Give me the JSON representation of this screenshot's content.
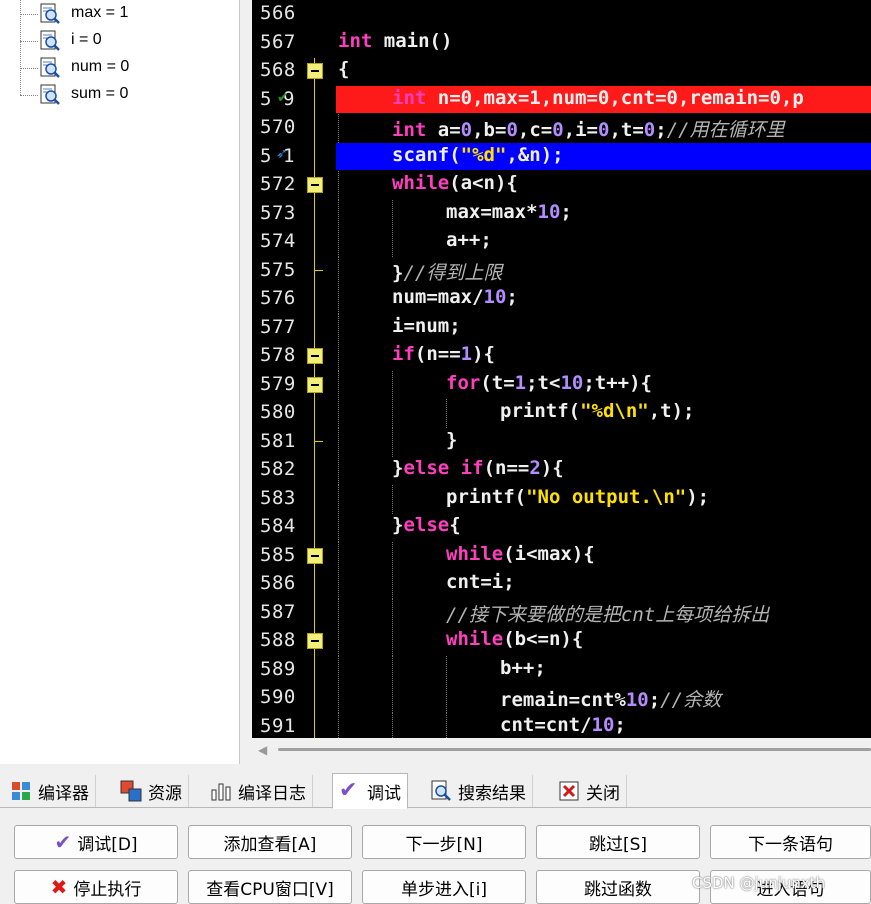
{
  "watch": {
    "items": [
      {
        "text": "max = 1"
      },
      {
        "text": "i = 0"
      },
      {
        "text": "num = 0"
      },
      {
        "text": "sum = 0"
      }
    ]
  },
  "editor": {
    "lines": [
      {
        "n": "566"
      },
      {
        "n": "567"
      },
      {
        "n": "568"
      },
      {
        "n": "5",
        "n2": "9"
      },
      {
        "n": "570"
      },
      {
        "n": "5",
        "n2": "1"
      },
      {
        "n": "572"
      },
      {
        "n": "573"
      },
      {
        "n": "574"
      },
      {
        "n": "575"
      },
      {
        "n": "576"
      },
      {
        "n": "577"
      },
      {
        "n": "578"
      },
      {
        "n": "579"
      },
      {
        "n": "580"
      },
      {
        "n": "581"
      },
      {
        "n": "582"
      },
      {
        "n": "583"
      },
      {
        "n": "584"
      },
      {
        "n": "585"
      },
      {
        "n": "586"
      },
      {
        "n": "587"
      },
      {
        "n": "588"
      },
      {
        "n": "589"
      },
      {
        "n": "590"
      },
      {
        "n": "591"
      }
    ],
    "code": {
      "l567": {
        "kw": "int",
        "rest": " main()"
      },
      "l568": "{",
      "l569": {
        "kw": "int",
        "rest": " n=0,max=1,num=0,cnt=0,remain=0,p"
      },
      "l570": {
        "kw": "int",
        "a": " a=",
        "z1": "0",
        "b": ",b=",
        "z2": "0",
        "c": ",c=",
        "z3": "0",
        "i": ",i=",
        "z4": "0",
        "t": ",t=",
        "z5": "0",
        "semi": ";",
        "cmt": "//用在循环里"
      },
      "l571": {
        "fn": "scanf(",
        "str": "\"%d\"",
        "rest": ",&n);"
      },
      "l572": {
        "kw": "while",
        "rest": "(a<n){"
      },
      "l573": {
        "a": "max=max*",
        "n": "10",
        "b": ";"
      },
      "l574": "a++;",
      "l575": {
        "a": "}",
        "cmt": "//得到上限"
      },
      "l576": {
        "a": "num=max/",
        "n": "10",
        "b": ";"
      },
      "l577": "i=num;",
      "l578": {
        "kw": "if",
        "a": "(n==",
        "n": "1",
        "b": "){"
      },
      "l579": {
        "kw": "for",
        "a": "(t=",
        "n1": "1",
        "b": ";t<",
        "n2": "10",
        "c": ";t++){"
      },
      "l580": {
        "a": "printf(",
        "str": "\"%d\\n\"",
        "b": ",t);"
      },
      "l581": "}",
      "l582": {
        "a": "}",
        "kw1": "else",
        "sp": " ",
        "kw2": "if",
        "b": "(n==",
        "n": "2",
        "c": "){"
      },
      "l583": {
        "a": "printf(",
        "str": "\"No output.\\n\"",
        "b": ");"
      },
      "l584": {
        "a": "}",
        "kw": "else",
        "b": "{"
      },
      "l585": {
        "kw": "while",
        "rest": "(i<max){"
      },
      "l586": "cnt=i;",
      "l587": {
        "cmt": "//接下来要做的是把cnt上每项给拆出"
      },
      "l588": {
        "kw": "while",
        "rest": "(b<=n){"
      },
      "l589": "b++;",
      "l590": {
        "a": "remain=cnt%",
        "n": "10",
        "b": ";",
        "cmt": "//余数"
      },
      "l591": {
        "a": "cnt=cnt/",
        "n": "10",
        "b": ";"
      }
    }
  },
  "tabs": [
    {
      "label": "编译器"
    },
    {
      "label": "资源"
    },
    {
      "label": "编译日志"
    },
    {
      "label": "调试"
    },
    {
      "label": "搜索结果"
    },
    {
      "label": "关闭"
    }
  ],
  "buttons": {
    "debug": "调试[D]",
    "add_watch": "添加查看[A]",
    "next_step": "下一步[N]",
    "skip": "跳过[S]",
    "next_statement": "下一条语句",
    "stop": "停止执行",
    "view_cpu": "查看CPU窗口[V]",
    "step_into": "单步进入[i]",
    "skip_function": "跳过函数",
    "into_statement": "进入语句"
  },
  "watermark": "CSDN @junjunxth",
  "colors": {
    "breakpoint_line": "#ff1a1a",
    "current_line": "#0000ff",
    "keyword": "#ff3fbf",
    "number": "#b48cff",
    "string": "#ffe000",
    "comment": "#b4b4b4"
  }
}
